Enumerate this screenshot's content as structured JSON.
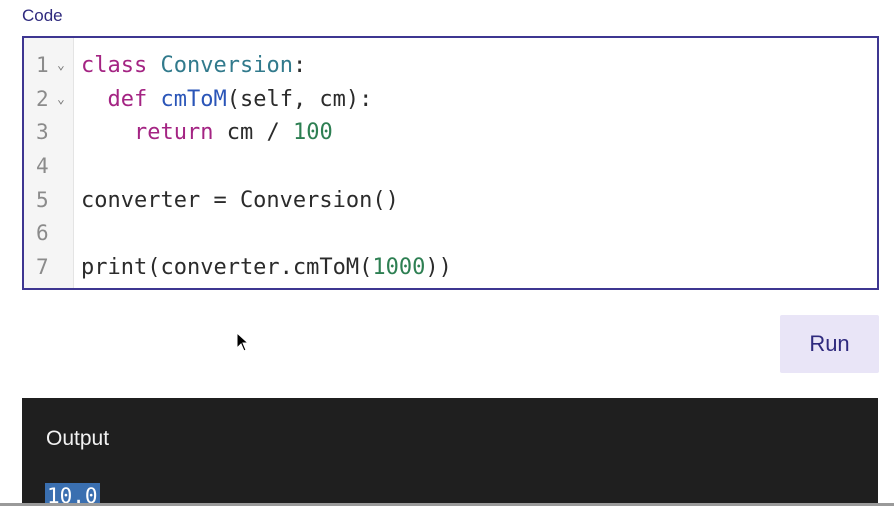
{
  "code_label": "Code",
  "editor": {
    "lines": [
      {
        "num": "1",
        "fold": "⌄",
        "tokens": [
          {
            "t": "class ",
            "c": "kw"
          },
          {
            "t": "Conversion",
            "c": "cls"
          },
          {
            "t": ":",
            "c": ""
          }
        ]
      },
      {
        "num": "2",
        "fold": "⌄",
        "tokens": [
          {
            "t": "  ",
            "c": ""
          },
          {
            "t": "def ",
            "c": "kw"
          },
          {
            "t": "cmToM",
            "c": "fn"
          },
          {
            "t": "(self, cm):",
            "c": ""
          }
        ]
      },
      {
        "num": "3",
        "fold": "",
        "tokens": [
          {
            "t": "    ",
            "c": ""
          },
          {
            "t": "return",
            "c": "kw"
          },
          {
            "t": " cm / ",
            "c": ""
          },
          {
            "t": "100",
            "c": "num"
          }
        ]
      },
      {
        "num": "4",
        "fold": "",
        "tokens": []
      },
      {
        "num": "5",
        "fold": "",
        "tokens": [
          {
            "t": "converter = Conversion()",
            "c": ""
          }
        ]
      },
      {
        "num": "6",
        "fold": "",
        "tokens": []
      },
      {
        "num": "7",
        "fold": "",
        "tokens": [
          {
            "t": "print(converter.cmToM(",
            "c": ""
          },
          {
            "t": "1000",
            "c": "num"
          },
          {
            "t": "))",
            "c": ""
          }
        ]
      }
    ]
  },
  "run_label": "Run",
  "output": {
    "title": "Output",
    "value": "10.0"
  },
  "colors": {
    "accent": "#3e3691",
    "keyword": "#a42483",
    "class_name": "#317a8c",
    "function_name": "#2a55b8",
    "number": "#2d7f52",
    "output_bg": "#1f1f1f",
    "selection": "#3a6fb0"
  },
  "icons": {
    "fold": "chevron-down-icon",
    "cursor": "mouse-pointer-icon"
  }
}
